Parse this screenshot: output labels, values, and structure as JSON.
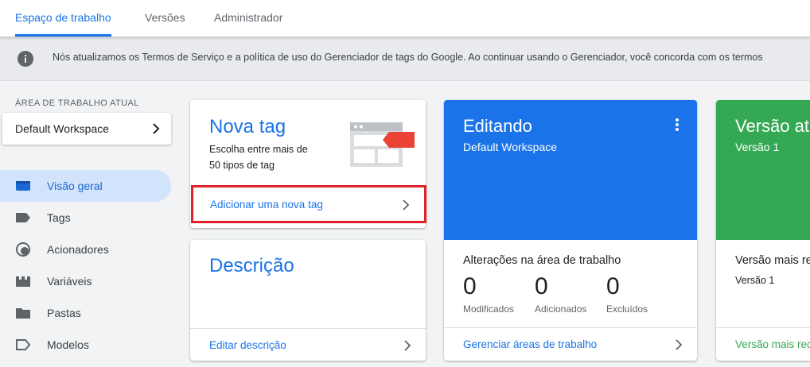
{
  "topnav": {
    "tabs": [
      {
        "label": "Espaço de trabalho",
        "active": true
      },
      {
        "label": "Versões",
        "active": false
      },
      {
        "label": "Administrador",
        "active": false
      }
    ]
  },
  "notice": {
    "icon": "info-icon",
    "text": "Nós atualizamos os Termos de Serviço e a política de uso do Gerenciador de tags do Google. Ao continuar usando o Gerenciador, você concorda com os termos"
  },
  "sidebar": {
    "section_label": "ÁREA DE TRABALHO ATUAL",
    "workspace": "Default Workspace",
    "items": [
      {
        "label": "Visão geral",
        "icon": "overview-icon",
        "active": true
      },
      {
        "label": "Tags",
        "icon": "tag-icon",
        "active": false
      },
      {
        "label": "Acionadores",
        "icon": "trigger-icon",
        "active": false
      },
      {
        "label": "Variáveis",
        "icon": "variables-icon",
        "active": false
      },
      {
        "label": "Pastas",
        "icon": "folder-icon",
        "active": false
      },
      {
        "label": "Modelos",
        "icon": "templates-icon",
        "active": false
      }
    ]
  },
  "new_tag_card": {
    "title": "Nova tag",
    "description_line1": "Escolha entre mais de",
    "description_line2": "50 tipos de tag",
    "link": "Adicionar uma nova tag"
  },
  "description_card": {
    "title": "Descrição",
    "link": "Editar descrição"
  },
  "editing_card": {
    "title": "Editando",
    "subtitle": "Default Workspace",
    "changes_label": "Alterações na área de trabalho",
    "counters": [
      {
        "value": "0",
        "label": "Modificados"
      },
      {
        "value": "0",
        "label": "Adicionados"
      },
      {
        "value": "0",
        "label": "Excluídos"
      }
    ],
    "link": "Gerenciar áreas de trabalho"
  },
  "version_card": {
    "title": "Versão ativa",
    "subtitle": "Versão 1",
    "section_label": "Versão mais recente",
    "section_value": "Versão 1",
    "link": "Versão mais recente"
  },
  "colors": {
    "accent": "#1a73e8",
    "editing": "#1a73e8",
    "version": "#34a853",
    "highlight_box": "#e0202a"
  }
}
